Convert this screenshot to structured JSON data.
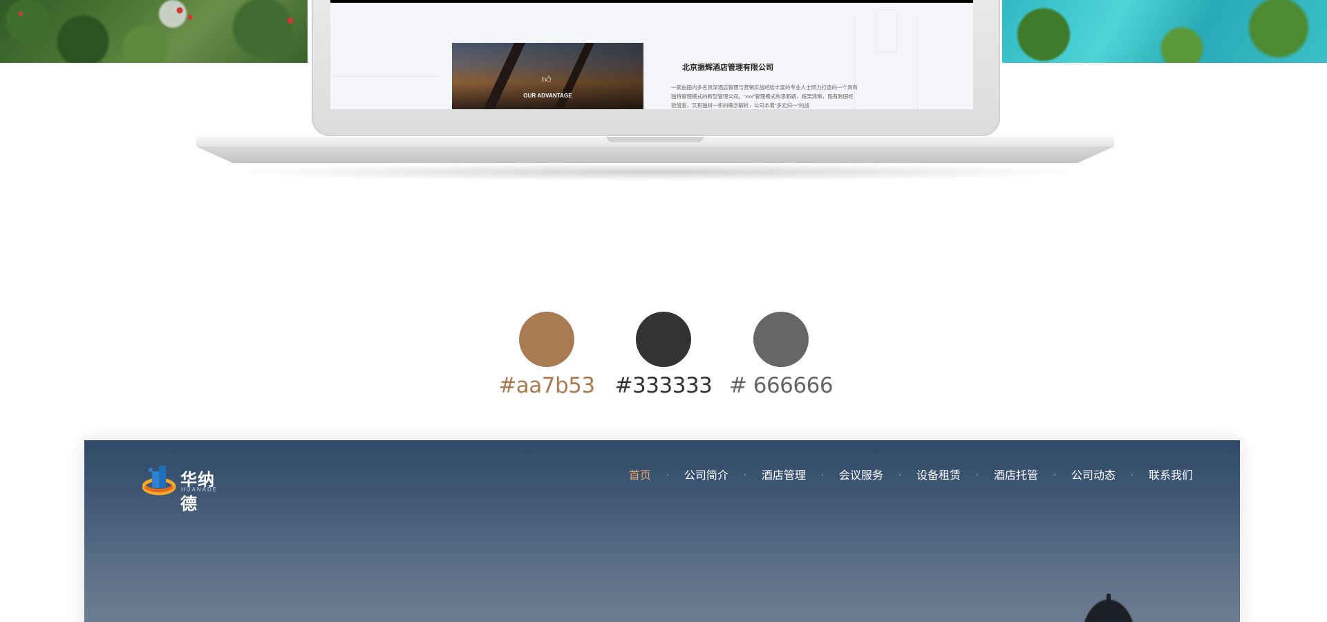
{
  "laptop_screen": {
    "photo_label": "OUR ADVANTAGE",
    "company_name": "北京振辉酒店管理有限公司",
    "description": "一家由国内多名资深酒店管理与营销实战经验丰富的专业人士倾力打造的一个具有独特管理模式的新型管理公司。“xxx”管理模式构思新颖，框架清晰，既有跨国经验借鉴，又有独树一帜的概念解析，公司本着“多元归一”的战"
  },
  "palette": {
    "swatches": [
      {
        "color": "#aa7b53",
        "label": "#aa7b53"
      },
      {
        "color": "#333333",
        "label": "#333333"
      },
      {
        "color": "#666666",
        "label": "# 666666"
      }
    ]
  },
  "site": {
    "logo": {
      "name_cn": "华纳德",
      "name_en": "HUANADE",
      "icon": "building-logo-icon"
    },
    "nav": [
      {
        "label": "首页",
        "active": true
      },
      {
        "label": "公司简介",
        "active": false
      },
      {
        "label": "酒店管理",
        "active": false
      },
      {
        "label": "会议服务",
        "active": false
      },
      {
        "label": "设备租赁",
        "active": false
      },
      {
        "label": "酒店托管",
        "active": false
      },
      {
        "label": "公司动态",
        "active": false
      },
      {
        "label": "联系我们",
        "active": false
      }
    ],
    "nav_separator": "·",
    "active_color": "#e0a66e"
  }
}
